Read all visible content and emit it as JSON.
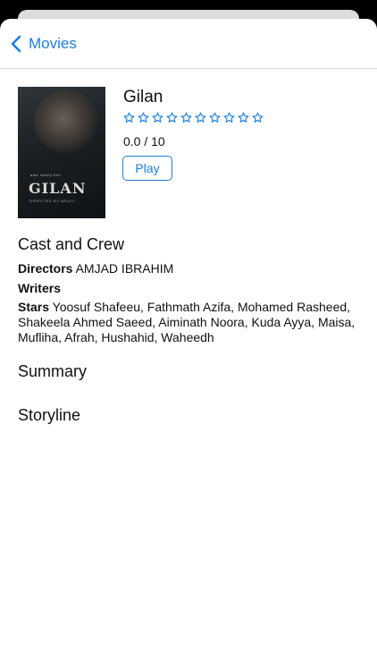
{
  "nav": {
    "back_label": "Movies"
  },
  "poster": {
    "title": "GILAN",
    "small_text": "ame family film",
    "credit_text": "DIRECTED BY ARLEY"
  },
  "movie": {
    "title": "Gilan",
    "star_count": 10,
    "rating_value": 0,
    "rating_text": "0.0 / 10",
    "play_label": "Play",
    "accent_color": "#1a7fe0"
  },
  "cast_crew": {
    "heading": "Cast and Crew",
    "directors_label": "Directors",
    "directors_value": "AMJAD IBRAHIM",
    "writers_label": "Writers",
    "stars_label": "Stars",
    "stars_value": "Yoosuf Shafeeu, Fathmath Azifa, Mohamed Rasheed, Shakeela Ahmed Saeed, Aiminath Noora, Kuda Ayya, Maisa, Mufliha, Afrah, Hushahid, Waheedh"
  },
  "summary": {
    "heading": "Summary"
  },
  "storyline": {
    "heading": "Storyline"
  }
}
